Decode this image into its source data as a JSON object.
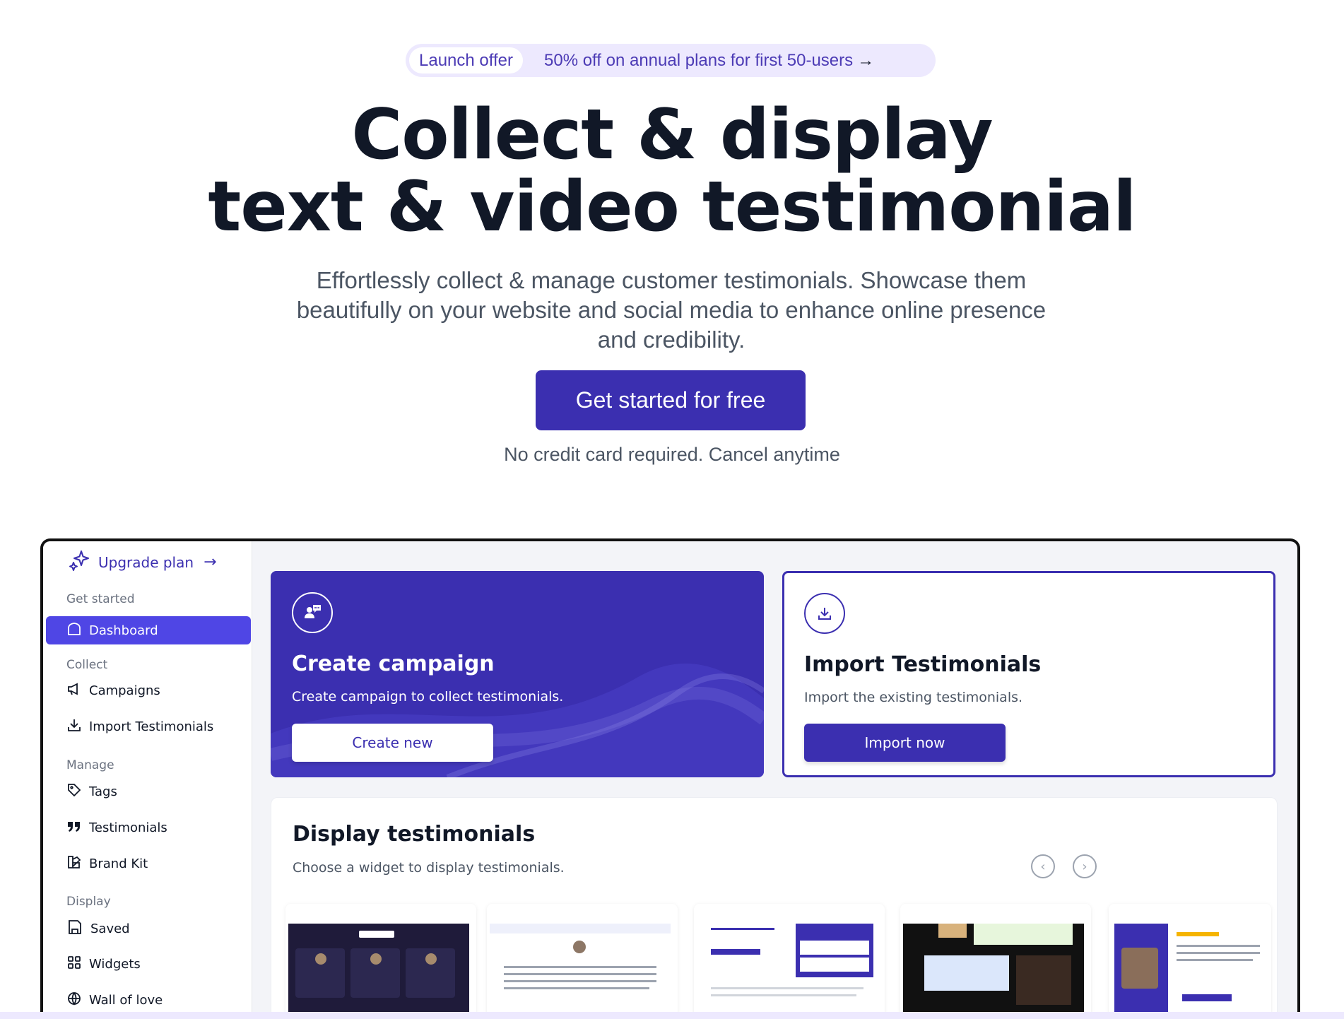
{
  "offer": {
    "tag": "Launch offer",
    "text": "50% off on annual plans for first 50-users",
    "arrow": "→"
  },
  "hero": {
    "title_line1": "Collect & display",
    "title_line2": "text & video testimonial",
    "subtitle": "Effortlessly collect & manage customer testimonials. Showcase them beautifully on your website and social media to enhance online presence and credibility.",
    "cta_label": "Get started for free",
    "note": "No credit card required. Cancel anytime"
  },
  "sidebar": {
    "upgrade_label": "Upgrade plan",
    "upgrade_arrow": "→",
    "sections": {
      "get_started": "Get started",
      "collect": "Collect",
      "manage": "Manage",
      "display": "Display"
    },
    "items": {
      "dashboard": "Dashboard",
      "campaigns": "Campaigns",
      "import": "Import Testimonials",
      "tags": "Tags",
      "testimonials": "Testimonials",
      "brand_kit": "Brand Kit",
      "saved": "Saved",
      "widgets": "Widgets",
      "wall_of_love": "Wall of love"
    }
  },
  "cards": {
    "create": {
      "title": "Create campaign",
      "desc": "Create campaign to collect testimonials.",
      "button": "Create new"
    },
    "import": {
      "title": "Import Testimonials",
      "desc": "Import the existing testimonials.",
      "button": "Import now"
    }
  },
  "display": {
    "title": "Display testimonials",
    "desc": "Choose a widget to display testimonials.",
    "prev": "‹",
    "next": "›"
  },
  "colors": {
    "primary": "#3b2fb0",
    "active_nav": "#4f46e5",
    "offer_bg": "#ede9fe"
  }
}
